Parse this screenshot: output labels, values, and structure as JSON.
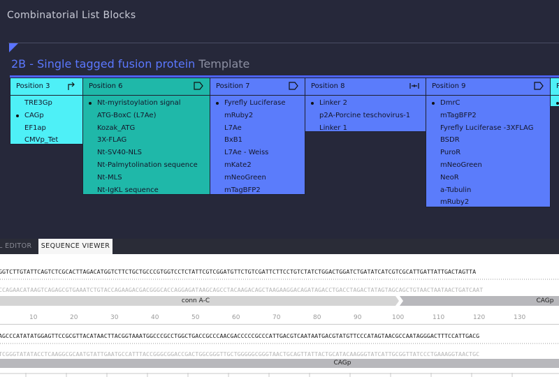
{
  "app": {
    "title": "Combinatorial List Blocks"
  },
  "template": {
    "name": "2B - Single tagged fusion protein",
    "suffix": "Template"
  },
  "colors": {
    "cyan": "#4ef0f7",
    "teal": "#1fb8a9",
    "blue": "#5b7cfb",
    "accent": "#4d63ff"
  },
  "columns": [
    {
      "label": "Position 3",
      "icon": "promoter-arrow-icon",
      "items": [
        "TRE3Gp",
        "CAGp",
        "EF1ap",
        "CMVp_Tet"
      ],
      "selected": 1
    },
    {
      "label": "Position 6",
      "icon": "cds-pentagon-icon",
      "items": [
        "Nt-myristoylation signal",
        "ATG-BoxC (L7Ae)",
        "Kozak_ATG",
        "3X-FLAG",
        "Nt-SV40-NLS",
        "Nt-Palmytolination sequence",
        "Nt-MLS",
        "Nt-IgKL sequence"
      ],
      "selected": 0
    },
    {
      "label": "Position 7",
      "icon": "cds-pentagon-icon",
      "items": [
        "Fyrefly Luciferase",
        "mRuby2",
        "L7Ae",
        "BxB1",
        "L7Ae - Weiss",
        "mKate2",
        "mNeoGreen",
        "mTagBFP2"
      ],
      "selected": 0
    },
    {
      "label": "Position 8",
      "icon": "linker-icon",
      "items": [
        "Linker 2",
        "p2A-Porcine teschovirus-1",
        "Linker 1"
      ],
      "selected": 0
    },
    {
      "label": "Position 9",
      "icon": "cds-pentagon-icon",
      "items": [
        "DmrC",
        "mTagBFP2",
        "Fyrefly Luciferase -3XFLAG",
        "BSDR",
        "PuroR",
        "mNeoGreen",
        "NeoR",
        "a-Tubulin",
        "mRuby2"
      ],
      "selected": 0
    },
    {
      "label": "P",
      "icon": "",
      "items": [
        ""
      ],
      "selected": 0
    }
  ],
  "tabs": {
    "editor": "L EDITOR",
    "viewer": "SEQUENCE VIEWER"
  },
  "sequence": {
    "row1_top": "GGTCTTGTATTCAGTCTCGCACTTAGACATGGTCTTCTGCTGCCCGTGGTCCTCTATTCGTCGGATGTTCTGTCGATTCTTCCTGTCTATCTGGACTGGATCTGATATCATCGTCGCATTGATTATTGACTAGTTA",
    "row1_comp": "CCAGAACATAAGTCAGAGCGTGAAATCTGTACCAGAAGACGACGGGCACCAGGAGATAAGCAGCCTACAAGACAGCTAAGAAGGACAGATAGACCTGACCTAGACTATAGTAGCAGCTGTAACTAATAACTGATCAAT",
    "ann1a": "conn A-C",
    "ann1b": "CAGp",
    "ruler": [
      "10",
      "20",
      "30",
      "40",
      "50",
      "60",
      "70",
      "80",
      "90",
      "100",
      "110",
      "120",
      "130"
    ],
    "row2_top": "AGCCCATATATGGAGTTCCGCGTTACATAACTTACGGTAAATGGCCCGCCTGGCTGACCGCCCAACGACCCCCGCCCATTGACGTCAATAATGACGTATGTTCCCATAGTAACGCCAATAGGGACTTTCCATTGACG",
    "row2_comp": "TCGGGTATATACCTCAAGGCGCAATGTATTGAATGCCATTTACCGGGCGGACCGACTGGCGGGTTGCTGGGGGCGGGTAACTGCAGTTATTACTGCATACAAGGGTATCATTGCGGTTATCCCTGAAAGGTAACTGC",
    "ann2": "CAGp"
  }
}
